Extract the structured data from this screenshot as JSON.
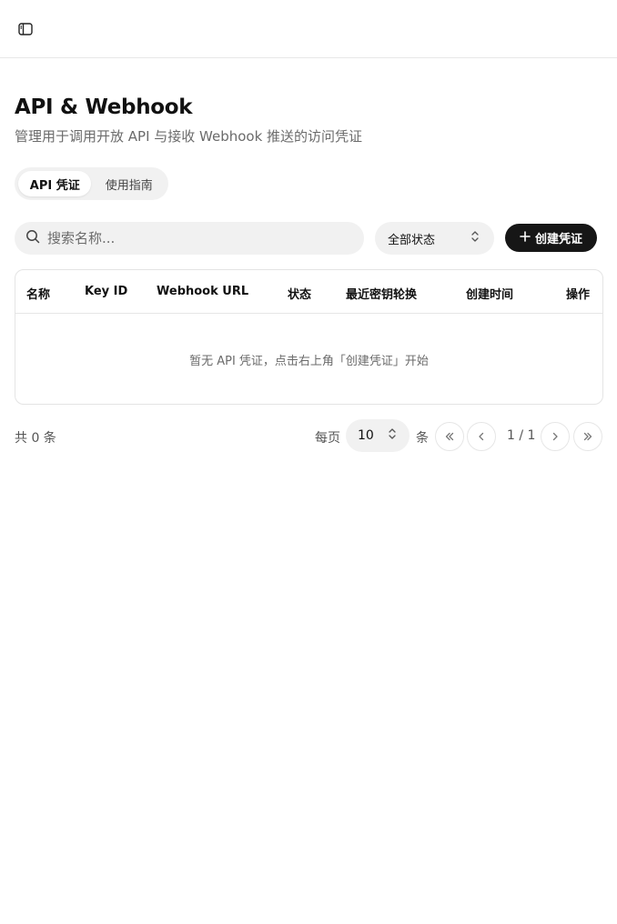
{
  "page": {
    "title": "API & Webhook",
    "subtitle": "管理用于调用开放 API 与接收 Webhook 推送的访问凭证"
  },
  "tabs": [
    {
      "label": "API 凭证",
      "active": true
    },
    {
      "label": "使用指南",
      "active": false
    }
  ],
  "toolbar": {
    "search_placeholder": "搜索名称...",
    "search_value": "",
    "status_filter": "全部状态",
    "create_label": "创建凭证"
  },
  "table": {
    "columns": [
      "名称",
      "Key ID",
      "Webhook URL",
      "状态",
      "最近密钥轮换",
      "创建时间",
      "操作"
    ],
    "rows": [],
    "empty_text": "暂无 API 凭证，点击右上角「创建凭证」开始"
  },
  "pagination": {
    "total_text": "共 0 条",
    "per_page_label": "每页",
    "page_size": "10",
    "per_page_unit": "条",
    "page_indicator": "1 / 1"
  },
  "icons": {
    "sidebar_toggle": "sidebar-toggle-icon",
    "search": "search-icon",
    "select": "chevron-up-down-icon",
    "create": "plus-icon",
    "first": "chevrons-left-icon",
    "prev": "chevron-left-icon",
    "next": "chevron-right-icon",
    "last": "chevrons-right-icon"
  },
  "colors": {
    "primary_button": "#161616",
    "surface": "#f1f1f1",
    "border": "#e4e4e4",
    "muted_text": "#6b6b6b"
  }
}
